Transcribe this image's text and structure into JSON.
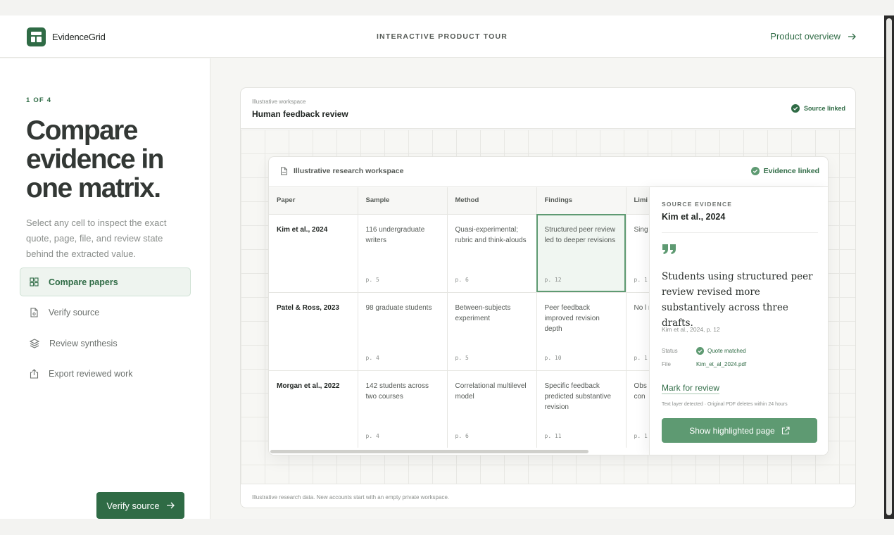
{
  "header": {
    "brand": "EvidenceGrid",
    "tour_title": "INTERACTIVE PRODUCT TOUR",
    "overview_link": "Product overview"
  },
  "sidebar": {
    "step": "1 OF 4",
    "headline": "Compare evidence in one matrix.",
    "description": "Select any cell to inspect the exact quote, page, file, and review state behind the extracted value.",
    "items": [
      {
        "label": "Compare papers",
        "icon": "grid-icon",
        "active": true
      },
      {
        "label": "Verify source",
        "icon": "document-icon",
        "active": false
      },
      {
        "label": "Review synthesis",
        "icon": "layers-icon",
        "active": false
      },
      {
        "label": "Export reviewed work",
        "icon": "share-icon",
        "active": false
      }
    ],
    "cta": "Verify source"
  },
  "workspace": {
    "subtitle": "Illustrative workspace",
    "title": "Human feedback review",
    "status": "Source linked",
    "footer": "Illustrative research data. New accounts start with an empty private workspace.",
    "inner_title": "Illustrative research workspace",
    "inner_status": "Evidence linked"
  },
  "table": {
    "columns": [
      "Paper",
      "Sample",
      "Method",
      "Findings",
      "Limi"
    ],
    "rows": [
      {
        "paper": "Kim et al., 2024",
        "sample": {
          "text": "116 undergraduate writers",
          "page": "p. 5"
        },
        "method": {
          "text": "Quasi-experimental; rubric and think-alouds",
          "page": "p. 6"
        },
        "findings": {
          "text": "Structured peer review led to deeper revisions",
          "page": "p. 12"
        },
        "limits": {
          "text": "Sing sho",
          "page": "p. 1"
        }
      },
      {
        "paper": "Patel & Ross, 2023",
        "sample": {
          "text": "98 graduate students",
          "page": "p. 4"
        },
        "method": {
          "text": "Between-subjects experiment",
          "page": "p. 5"
        },
        "findings": {
          "text": "Peer feedback improved revision depth",
          "page": "p. 10"
        },
        "limits": {
          "text": "No l rete",
          "page": "p. 1"
        }
      },
      {
        "paper": "Morgan et al., 2022",
        "sample": {
          "text": "142 students across two courses",
          "page": "p. 4"
        },
        "method": {
          "text": "Correlational multilevel model",
          "page": "p. 6"
        },
        "findings": {
          "text": "Specific feedback predicted substantive revision",
          "page": "p. 11"
        },
        "limits": {
          "text": "Obs desi con",
          "page": "p. 1"
        }
      }
    ],
    "selected": {
      "row": 0,
      "column": "findings"
    }
  },
  "evidence": {
    "label": "SOURCE EVIDENCE",
    "paper": "Kim et al., 2024",
    "quote": "Students using structured peer review revised more substantively across three drafts.",
    "citation": "Kim et al., 2024, p. 12",
    "status_key": "Status",
    "status_value": "Quote matched",
    "file_key": "File",
    "file_value": "Kim_et_al_2024.pdf",
    "mark_link": "Mark for review",
    "detected_note": "Text layer detected · Original PDF deletes within 24 hours",
    "button": "Show highlighted page"
  },
  "colors": {
    "brand": "#2f6b45",
    "button_light": "#5e9a72",
    "selected_cell": "#f0f6f1"
  }
}
